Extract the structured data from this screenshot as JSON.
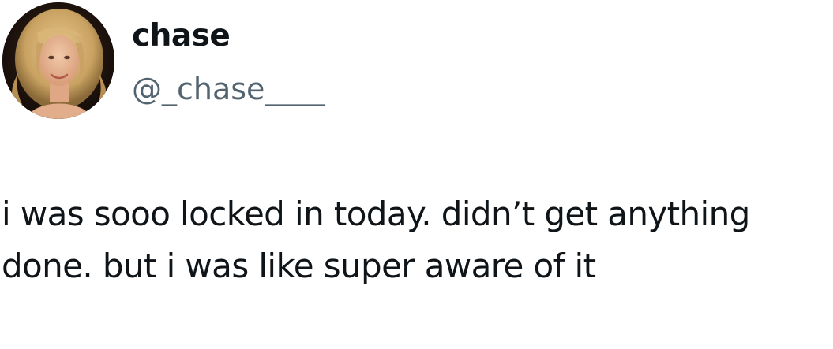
{
  "tweet": {
    "author": {
      "display_name": "chase",
      "handle": "@_chase____",
      "avatar_icon": "profile-photo-avatar"
    },
    "text": "i was sooo locked in today. didn’t get anything done. but i was like super aware of it"
  },
  "colors": {
    "text_primary": "#0f1419",
    "text_secondary": "#536471",
    "background": "#ffffff"
  }
}
